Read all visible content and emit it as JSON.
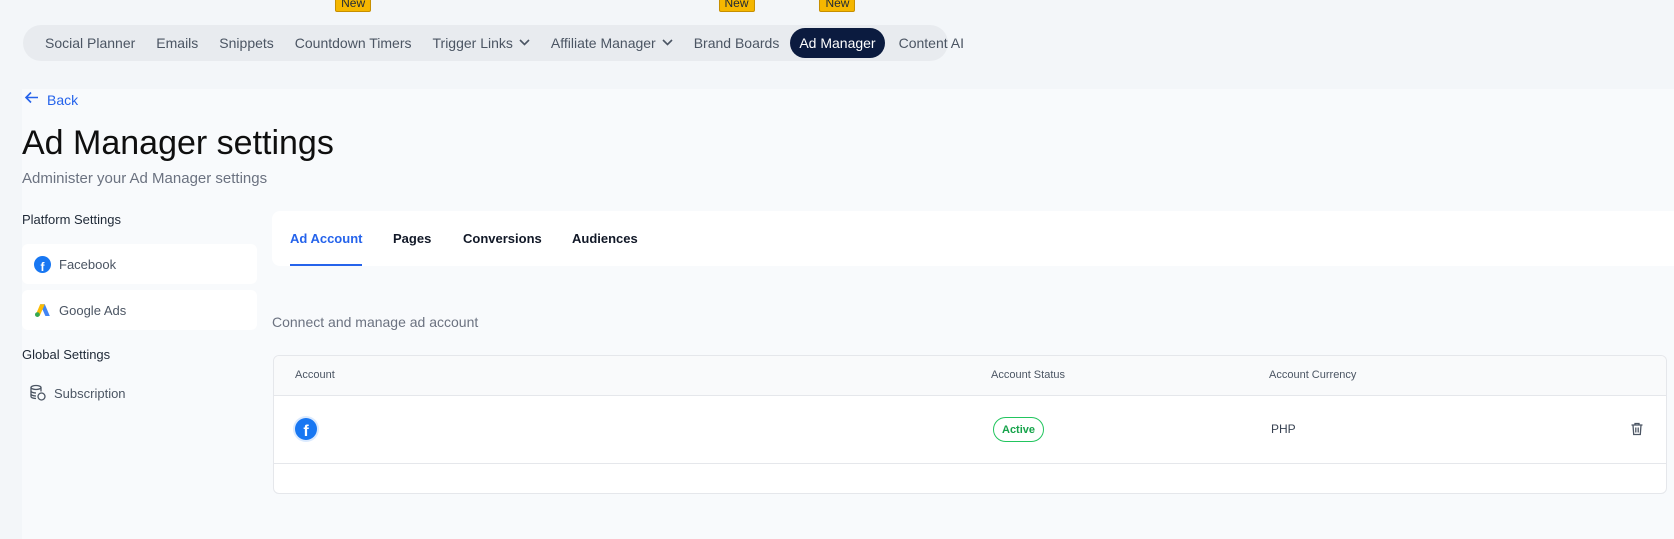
{
  "nav": {
    "items": [
      {
        "label": "Social Planner"
      },
      {
        "label": "Emails"
      },
      {
        "label": "Snippets"
      },
      {
        "label": "Countdown Timers",
        "badge": "New"
      },
      {
        "label": "Trigger Links"
      },
      {
        "label": "Affiliate Manager"
      },
      {
        "label": "Brand Boards",
        "badge": "New"
      },
      {
        "label": "Ad Manager",
        "badge": "New"
      },
      {
        "label": "Content AI"
      }
    ]
  },
  "back_label": "Back",
  "page": {
    "title": "Ad Manager settings",
    "subtitle": "Administer your Ad Manager settings"
  },
  "sidebar": {
    "platform_heading": "Platform Settings",
    "platform_items": [
      {
        "label": "Facebook",
        "icon": "facebook-icon"
      },
      {
        "label": "Google Ads",
        "icon": "google-ads-icon"
      }
    ],
    "global_heading": "Global Settings",
    "global_items": [
      {
        "label": "Subscription",
        "icon": "subscription-icon"
      }
    ]
  },
  "tabs": [
    {
      "label": "Ad Account",
      "active": true
    },
    {
      "label": "Pages"
    },
    {
      "label": "Conversions"
    },
    {
      "label": "Audiences"
    }
  ],
  "section_title": "Connect and manage ad account",
  "table": {
    "headers": [
      "Account",
      "Account Status",
      "Account Currency"
    ],
    "rows": [
      {
        "account_icon": "facebook-icon",
        "account": "",
        "status": "Active",
        "currency": "PHP"
      }
    ]
  },
  "colors": {
    "accent": "#2563eb",
    "active_nav": "#0b1b3f",
    "badge_new": "#f5b700",
    "status_active": "#16a34a"
  }
}
